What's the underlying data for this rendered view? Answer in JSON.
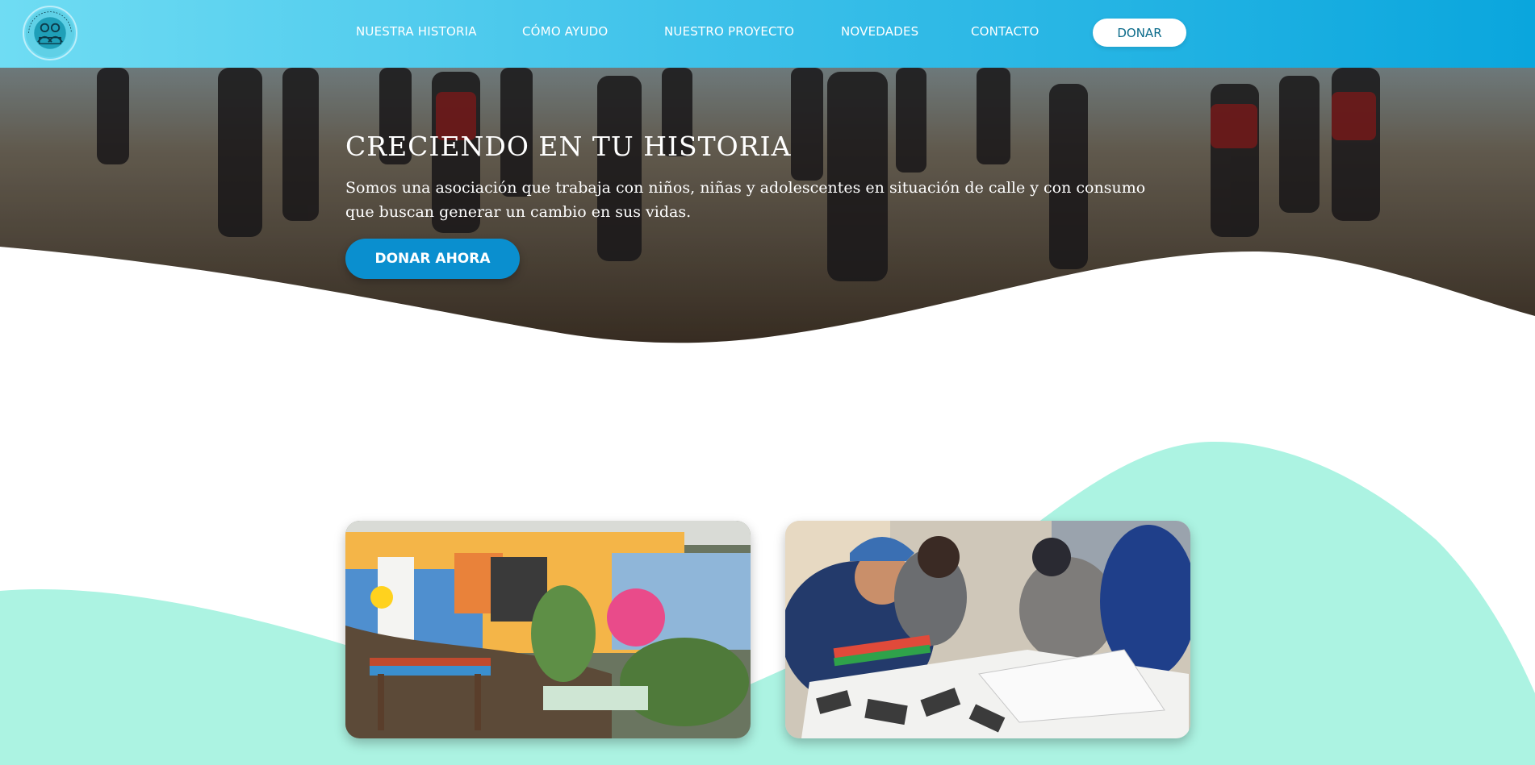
{
  "brand": {
    "logo_alt": "Creciendo en tu historia",
    "logo_icon": "family-logo-icon",
    "colors": {
      "nav_start": "#6fdcf3",
      "nav_end": "#0aa6dd",
      "accent": "#0a8fcf",
      "mint": "#acf3e2"
    }
  },
  "nav": {
    "items": [
      {
        "label": "NUESTRA HISTORIA"
      },
      {
        "label": "CÓMO AYUDO"
      },
      {
        "label": "NUESTRO PROYECTO"
      },
      {
        "label": "NOVEDADES"
      },
      {
        "label": "CONTACTO"
      }
    ],
    "donate_label": "DONAR"
  },
  "hero": {
    "title": "CRECIENDO EN TU HISTORIA",
    "description": "Somos una asociación que trabaja con niños, niñas y adolescentes en situación de calle y con consumo que buscan generar un cambio en sus vidas.",
    "cta_label": "DONAR AHORA",
    "image": "youth-playing-soccer-photo"
  },
  "gallery": {
    "images": [
      {
        "name": "colorful-house-mural-photo"
      },
      {
        "name": "youth-drawing-at-table-photo"
      }
    ]
  }
}
